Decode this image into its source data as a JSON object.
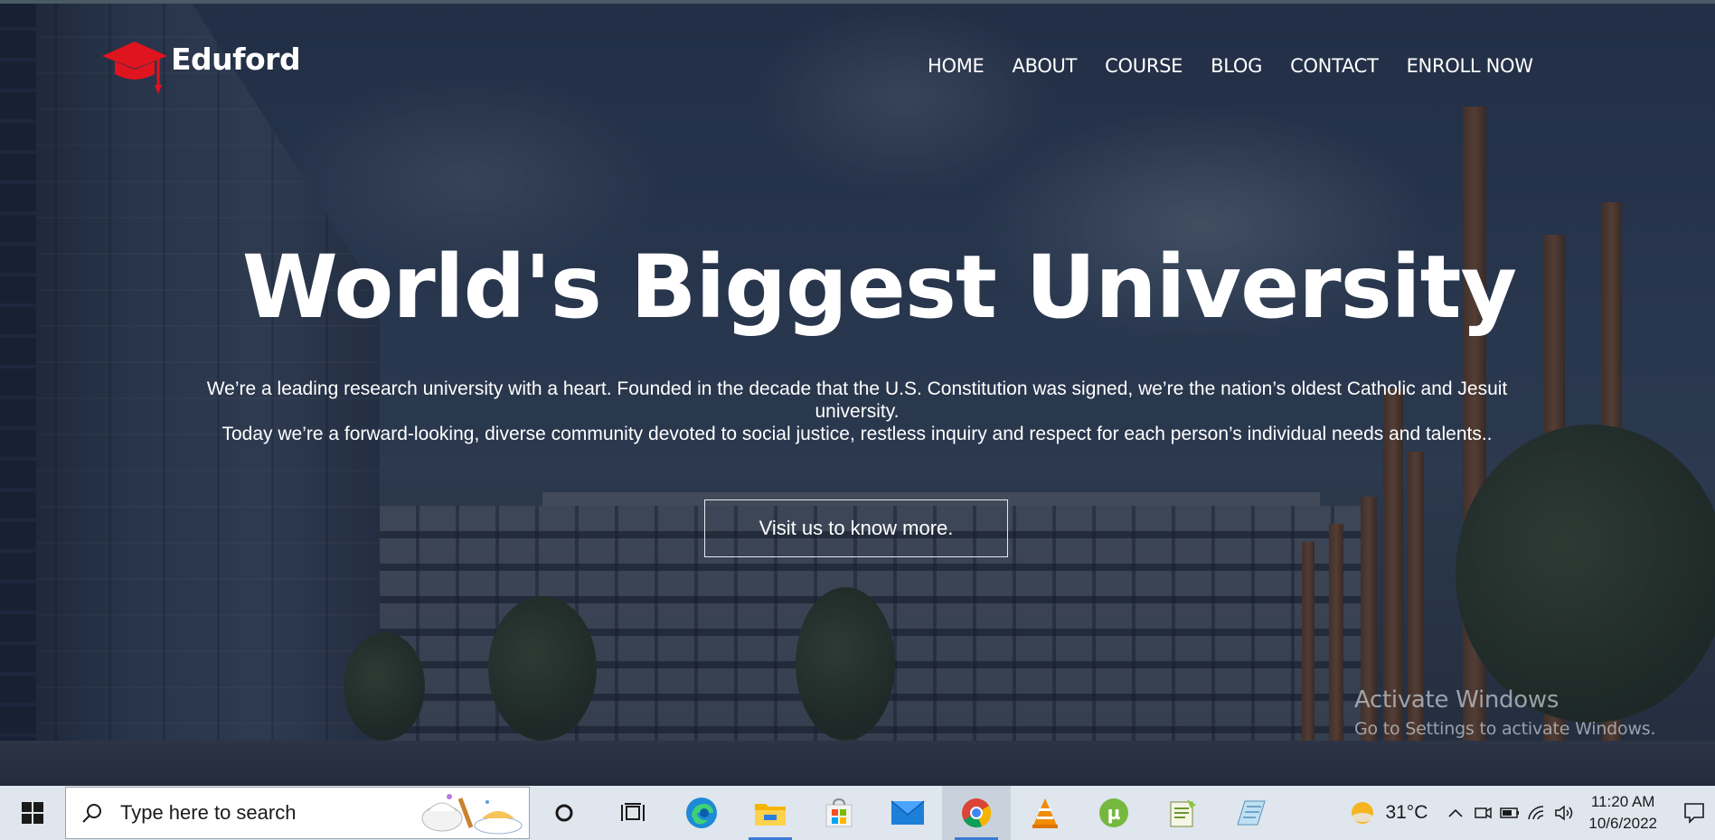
{
  "site": {
    "logo_text": "Eduford",
    "nav": [
      "HOME",
      "ABOUT",
      "COURSE",
      "BLOG",
      "CONTACT",
      "ENROLL NOW"
    ]
  },
  "hero": {
    "title": "World's Biggest University",
    "paragraph_line1": "We’re a leading research university with a heart. Founded in the decade that the U.S. Constitution was signed, we’re the nation’s oldest Catholic and Jesuit",
    "paragraph_line2": "university.",
    "paragraph_line3": "Today we’re a forward-looking, diverse community devoted to social justice, restless inquiry and respect for each person’s individual needs and talents..",
    "cta_label": "Visit us to know more."
  },
  "watermark": {
    "title": "Activate Windows",
    "subtitle": "Go to Settings to activate Windows."
  },
  "taskbar": {
    "search_placeholder": "Type here to search",
    "apps": [
      "cortana-icon",
      "task-view-icon",
      "edge-icon",
      "file-explorer-icon",
      "store-icon",
      "mail-icon",
      "chrome-icon",
      "vlc-icon",
      "utorrent-icon",
      "notepad-plus-icon",
      "notes-icon"
    ],
    "active_app": "chrome-icon",
    "weather": "31°C",
    "time": "11:20 AM",
    "date": "10/6/2022"
  },
  "colors": {
    "logo_red": "#e0141e",
    "taskbar_bg": "#dfe6ee",
    "text_white": "#ffffff"
  }
}
